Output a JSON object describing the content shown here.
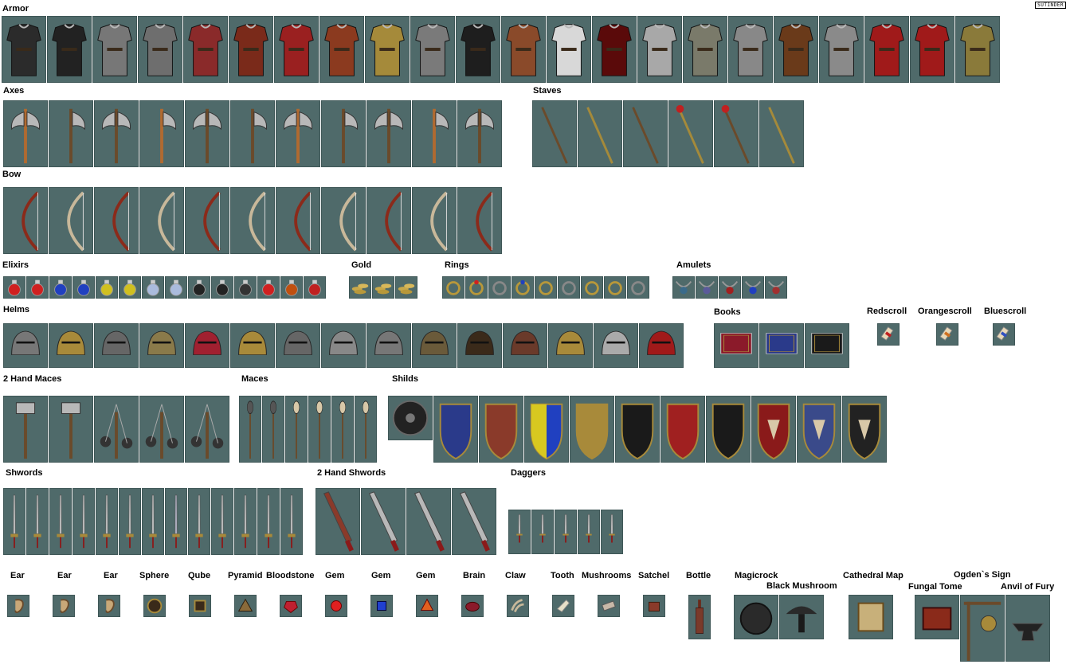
{
  "logo": "SUTINDER",
  "sections": {
    "armor": {
      "label": "Armor",
      "count": 22
    },
    "axes": {
      "label": "Axes",
      "count": 11
    },
    "staves": {
      "label": "Staves",
      "count": 6
    },
    "bow": {
      "label": "Bow",
      "count": 11
    },
    "elixirs": {
      "label": "Elixirs",
      "count": 14
    },
    "gold": {
      "label": "Gold",
      "count": 3
    },
    "rings": {
      "label": "Rings",
      "count": 9
    },
    "amulets": {
      "label": "Amulets",
      "count": 5
    },
    "helms": {
      "label": "Helms",
      "count": 15
    },
    "books": {
      "label": "Books",
      "count": 3
    },
    "redscroll": {
      "label": "Redscroll"
    },
    "orangescroll": {
      "label": "Orangescroll"
    },
    "bluescroll": {
      "label": "Bluescroll"
    },
    "two_hand_maces": {
      "label": "2 Hand Maces",
      "count": 5
    },
    "maces": {
      "label": "Maces",
      "count": 6
    },
    "shilds": {
      "label": "Shilds",
      "count": 11
    },
    "shwords": {
      "label": "Shwords",
      "count": 13
    },
    "two_hand_shwords": {
      "label": "2 Hand Shwords",
      "count": 4
    },
    "daggers": {
      "label": "Daggers",
      "count": 5
    }
  },
  "misc": [
    {
      "label": "Ear",
      "icon": "ear-icon"
    },
    {
      "label": "Ear",
      "icon": "ear-icon"
    },
    {
      "label": "Ear",
      "icon": "ear-icon"
    },
    {
      "label": "Sphere",
      "icon": "sphere-icon"
    },
    {
      "label": "Qube",
      "icon": "cube-icon"
    },
    {
      "label": "Pyramid",
      "icon": "pyramid-icon"
    },
    {
      "label": "Bloodstone",
      "icon": "bloodstone-icon"
    },
    {
      "label": "Gem",
      "icon": "red-gem-icon"
    },
    {
      "label": "Gem",
      "icon": "blue-gem-icon"
    },
    {
      "label": "Gem",
      "icon": "orange-gem-icon"
    },
    {
      "label": "Brain",
      "icon": "brain-icon"
    },
    {
      "label": "Claw",
      "icon": "claw-icon"
    },
    {
      "label": "Tooth",
      "icon": "tooth-icon"
    },
    {
      "label": "Mushrooms",
      "icon": "mushrooms-icon"
    },
    {
      "label": "Satchel",
      "icon": "satchel-icon"
    },
    {
      "label": "Bottle",
      "icon": "bottle-icon"
    },
    {
      "label": "Magicrock",
      "icon": "magic-rock-icon"
    },
    {
      "label": "Black Mushroom",
      "icon": "black-mushroom-icon"
    },
    {
      "label": "Cathedral Map",
      "icon": "map-icon"
    },
    {
      "label": "Fungal Tome",
      "icon": "tome-icon"
    },
    {
      "label": "Ogden`s Sign",
      "icon": "sign-icon"
    },
    {
      "label": "Anvil of Fury",
      "icon": "anvil-icon"
    }
  ],
  "colors": {
    "tile_bg": "#4f6a6a",
    "metal": "#b8b8b8",
    "red": "#8b1a1a",
    "gold": "#a88a3a",
    "wood": "#6b4a2a"
  }
}
